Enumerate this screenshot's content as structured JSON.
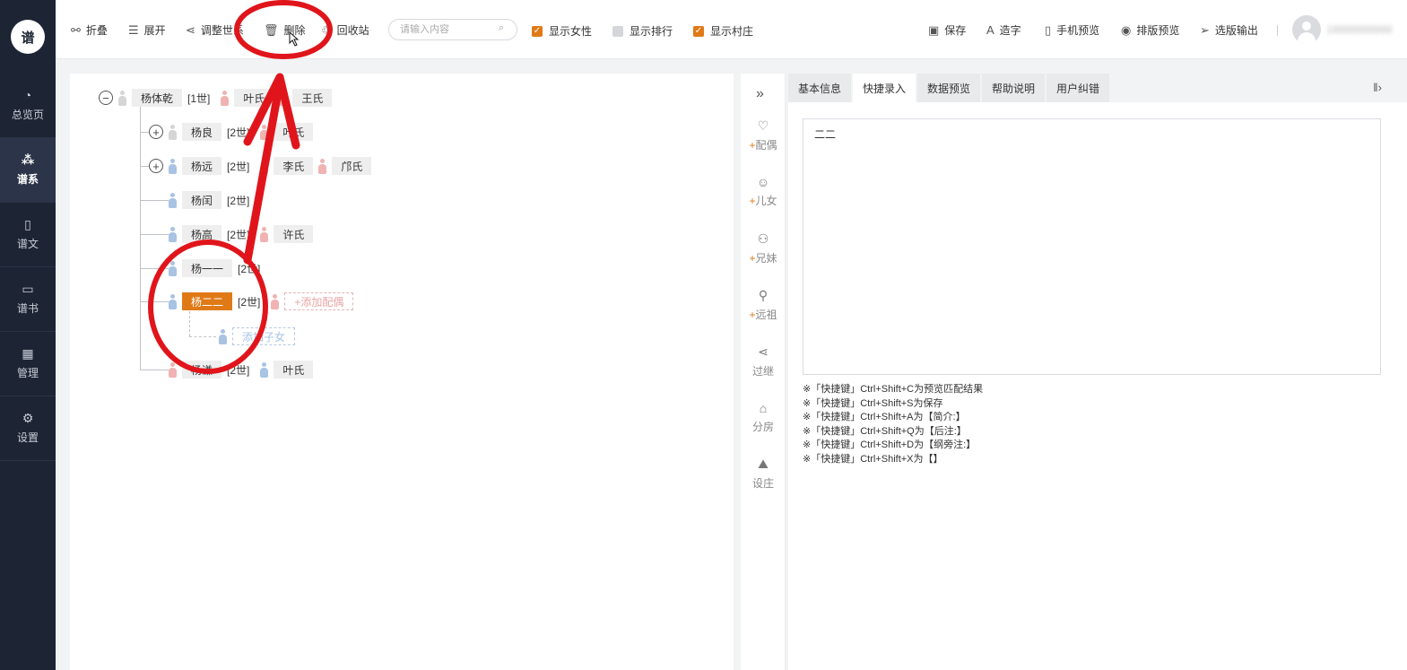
{
  "sidebar": {
    "logo_text": "谱",
    "items": [
      {
        "label": "总览页",
        "icon": "pie-chart-icon"
      },
      {
        "label": "谱系",
        "icon": "tree-icon"
      },
      {
        "label": "谱文",
        "icon": "document-icon"
      },
      {
        "label": "谱书",
        "icon": "book-icon"
      },
      {
        "label": "管理",
        "icon": "grid-icon"
      },
      {
        "label": "设置",
        "icon": "gear-icon"
      }
    ]
  },
  "toolbar": {
    "fold": "折叠",
    "expand": "展开",
    "adjust": "调整世系",
    "delete": "删除",
    "recycle": "回收站",
    "search_placeholder": "请输入内容",
    "show_female": "显示女性",
    "show_rank": "显示排行",
    "show_village": "显示村庄",
    "save": "保存",
    "make_char": "造字",
    "mobile_preview": "手机预览",
    "layout_preview": "排版预览",
    "export": "选版输出",
    "user_name": "18888888888"
  },
  "tree": {
    "root": {
      "name": "杨体乾",
      "gen": "[1世]",
      "spouse1": "叶氏",
      "spouse2": "王氏"
    },
    "children": [
      {
        "name": "杨良",
        "gen": "[2世]",
        "spouse1": "叶氏"
      },
      {
        "name": "杨远",
        "gen": "[2世]",
        "spouse1": "李氏",
        "spouse2": "邝氏"
      },
      {
        "name": "杨闰",
        "gen": "[2世]"
      },
      {
        "name": "杨高",
        "gen": "[2世]",
        "spouse1": "许氏"
      },
      {
        "name": "杨一一",
        "gen": "[2世]"
      },
      {
        "name": "杨二二",
        "gen": "[2世]",
        "add_spouse": "+添加配偶",
        "add_child": "添加子女"
      },
      {
        "name": "杨谦",
        "gen": "[2世]",
        "spouse1": "叶氏"
      }
    ]
  },
  "tools": {
    "spouse": "配偶",
    "children": "儿女",
    "siblings": "兄妹",
    "ancestor": "远祖",
    "adopt": "过继",
    "branch": "分房",
    "settle": "设庄",
    "plus": "+"
  },
  "panel": {
    "tabs": [
      "基本信息",
      "快捷录入",
      "数据预览",
      "帮助说明",
      "用户纠错"
    ],
    "active_tab": 1,
    "editor_value": "二二",
    "hints": [
      "※「快捷键」Ctrl+Shift+C为预览匹配结果",
      "※「快捷键」Ctrl+Shift+S为保存",
      "※「快捷键」Ctrl+Shift+A为【简介:】",
      "※「快捷键」Ctrl+Shift+Q为【后注:】",
      "※「快捷键」Ctrl+Shift+D为【纲旁注:】",
      "※「快捷键」Ctrl+Shift+X为【】"
    ]
  },
  "colors": {
    "accent": "#e07a17",
    "sidebar_bg": "#1d2434",
    "annotation": "#e0151b",
    "male": "#a9c3e3",
    "female": "#f0b2b2"
  }
}
